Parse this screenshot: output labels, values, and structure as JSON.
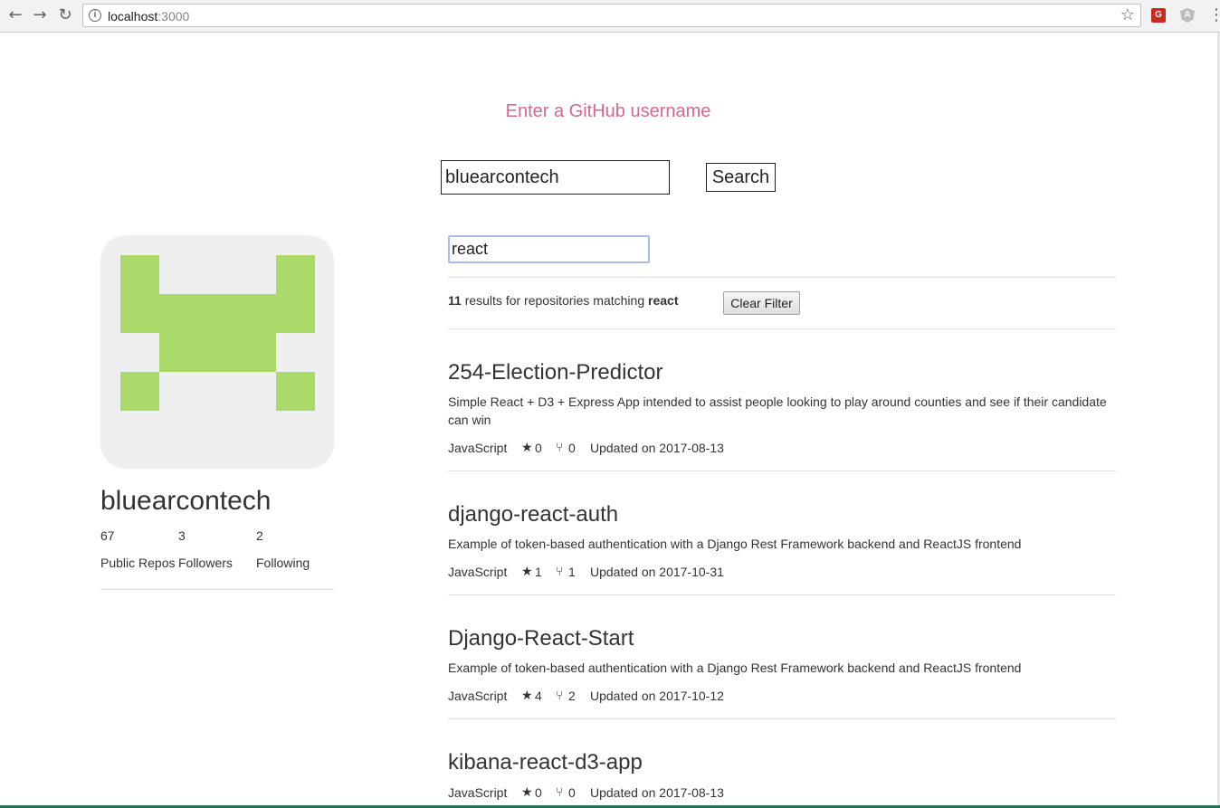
{
  "browser": {
    "url_host": "localhost",
    "url_port": ":3000"
  },
  "header": {
    "title": "Enter a GitHub username",
    "username_value": "bluearcontech",
    "search_label": "Search"
  },
  "profile": {
    "name": "bluearcontech",
    "stats": [
      {
        "value": "67",
        "label": "Public Repos"
      },
      {
        "value": "3",
        "label": "Followers"
      },
      {
        "value": "2",
        "label": "Following"
      }
    ],
    "avatar_color": "#aada6a"
  },
  "filter": {
    "value": "react",
    "result_count": "11",
    "result_text": " results for repositories matching ",
    "query": "react",
    "clear_label": "Clear Filter"
  },
  "repos": [
    {
      "name": "254-Election-Predictor",
      "description": "Simple React + D3 + Express App intended to assist people looking to play around counties and see if their candidate can win",
      "language": "JavaScript",
      "stars": "0",
      "forks": "0",
      "updated": "Updated on 2017-08-13"
    },
    {
      "name": "django-react-auth",
      "description": "Example of token-based authentication with a Django Rest Framework backend and ReactJS frontend",
      "language": "JavaScript",
      "stars": "1",
      "forks": "1",
      "updated": "Updated on 2017-10-31"
    },
    {
      "name": "Django-React-Start",
      "description": "Example of token-based authentication with a Django Rest Framework backend and ReactJS frontend",
      "language": "JavaScript",
      "stars": "4",
      "forks": "2",
      "updated": "Updated on 2017-10-12"
    },
    {
      "name": "kibana-react-d3-app",
      "description": "",
      "language": "JavaScript",
      "stars": "0",
      "forks": "0",
      "updated": "Updated on 2017-08-13"
    }
  ]
}
